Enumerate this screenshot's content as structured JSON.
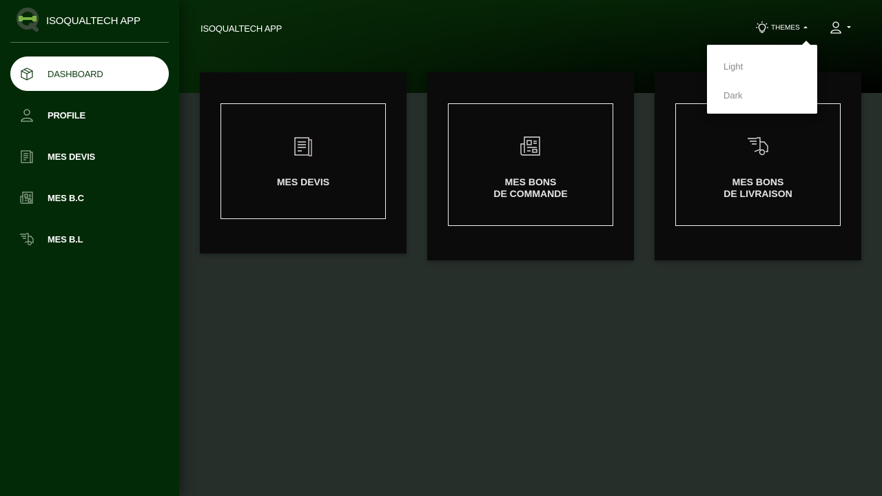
{
  "sidebar": {
    "brand_name": "ISOQUALTECH APP",
    "items": [
      {
        "label": "DASHBOARD",
        "icon": "box-icon",
        "active": true
      },
      {
        "label": "PROFILE",
        "icon": "user-icon"
      },
      {
        "label": "MES DEVIS",
        "icon": "document-icon"
      },
      {
        "label": "MES B.C",
        "icon": "newspaper-icon"
      },
      {
        "label": "MES B.L",
        "icon": "delivery-truck-icon"
      }
    ]
  },
  "topbar": {
    "title": "ISOQUALTECH APP",
    "themes_label": "THEMES"
  },
  "themes_menu": {
    "options": [
      "Light",
      "Dark"
    ]
  },
  "cards": [
    {
      "label": "MES DEVIS",
      "icon": "document-icon"
    },
    {
      "label": "MES BONS\nDE COMMANDE",
      "icon": "newspaper-icon"
    },
    {
      "label": "MES BONS\nDE LIVRAISON",
      "icon": "delivery-truck-icon"
    }
  ],
  "colors": {
    "sidebar_bg": "#032a06",
    "content_bg": "#272f2b",
    "card_bg": "#0b0b0b",
    "brand_green": "#7cb342"
  }
}
